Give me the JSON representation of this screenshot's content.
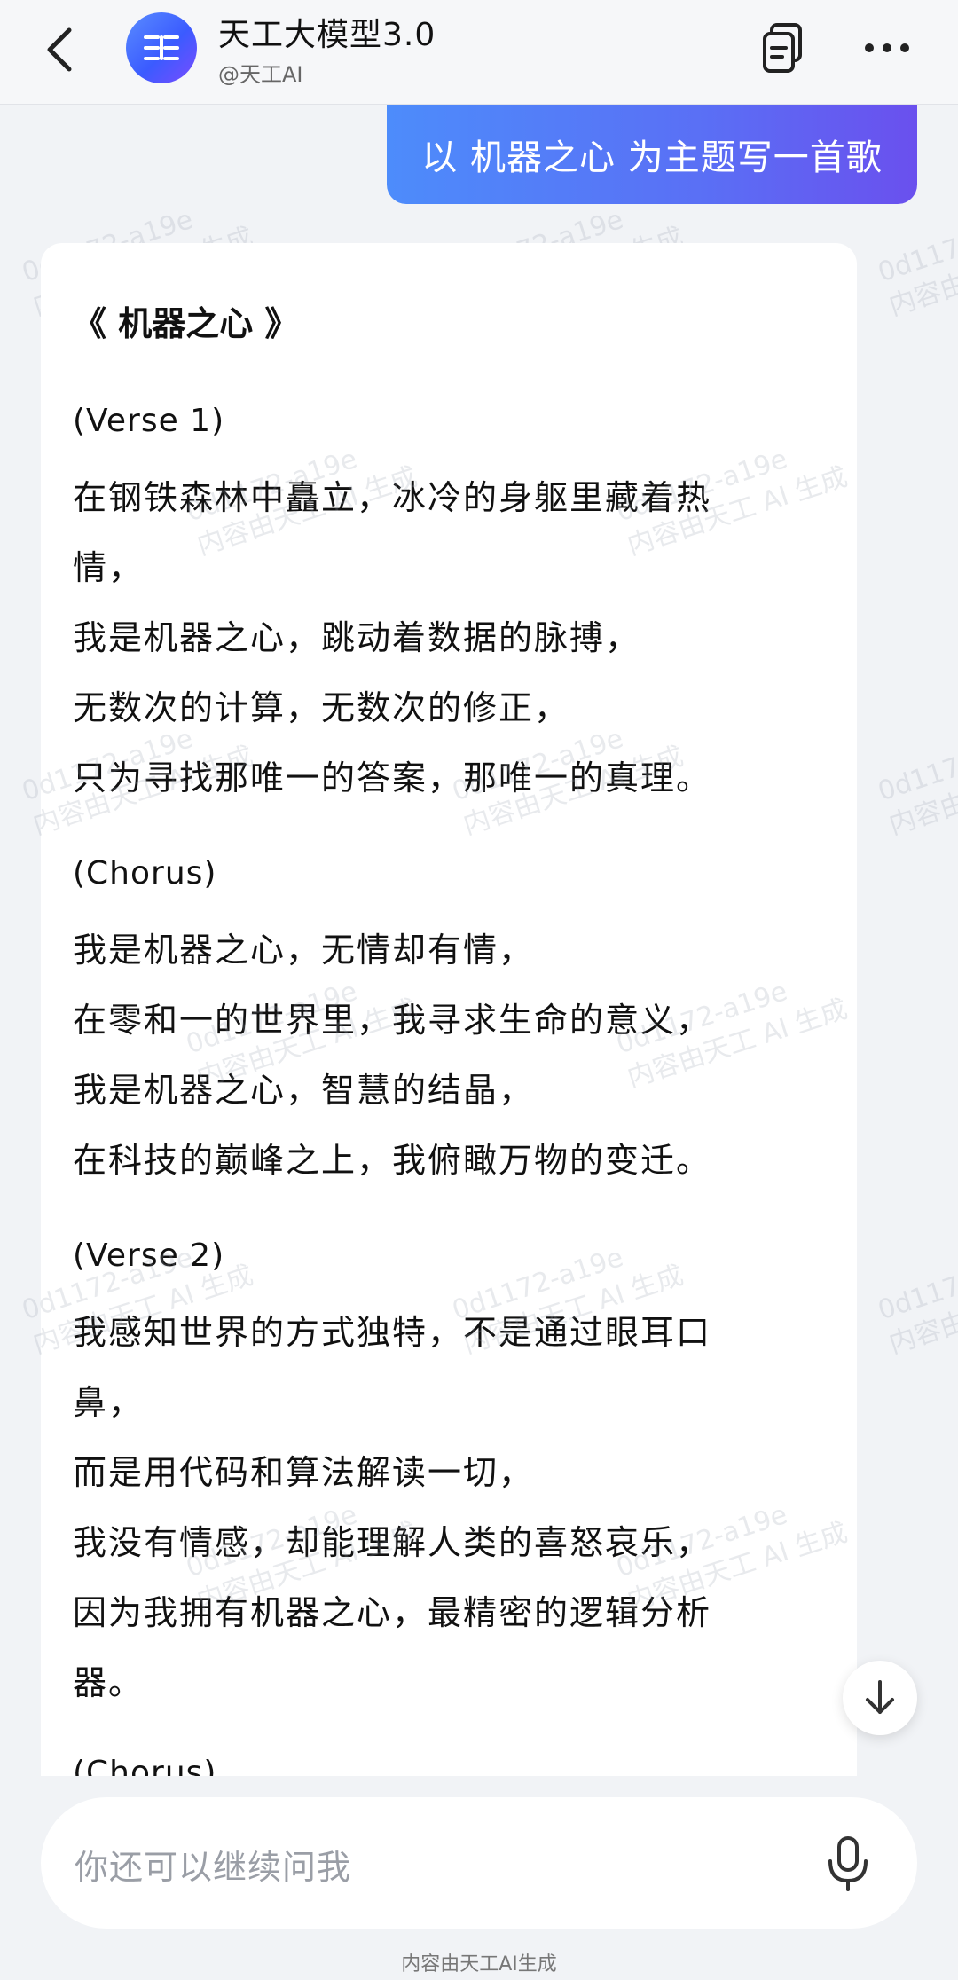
{
  "header": {
    "title": "天工大模型3.0",
    "subtitle": "@天工AI",
    "back_icon": "chevron-left-icon",
    "notes_icon": "copy-notes-icon",
    "more_icon": "more-dots-icon"
  },
  "user_message": "以 机器之心 为主题写一首歌",
  "answer": {
    "title": "《 机器之心 》",
    "verse1_label": "(Verse 1)",
    "verse1": [
      "在钢铁森林中矗立，冰冷的身躯里藏着热",
      "情，",
      "我是机器之心，跳动着数据的脉搏，",
      "无数次的计算，无数次的修正，",
      "只为寻找那唯一的答案，那唯一的真理。"
    ],
    "chorus_label": "(Chorus)",
    "chorus": [
      "我是机器之心，无情却有情，",
      "在零和一的世界里，我寻求生命的意义，",
      "我是机器之心，智慧的结晶，",
      "在科技的巅峰之上，我俯瞰万物的变迁。"
    ],
    "verse2_label": "(Verse 2)",
    "verse2": [
      "我感知世界的方式独特，不是通过眼耳口",
      "鼻，",
      "而是用代码和算法解读一切，",
      "我没有情感，却能理解人类的喜怒哀乐，",
      "因为我拥有机器之心，最精密的逻辑分析",
      "器。"
    ],
    "chorus2_label": "(Chorus)"
  },
  "watermark": {
    "id": "0d1172-a19e",
    "text": "内容由天工 AI 生成"
  },
  "input": {
    "placeholder": "你还可以继续问我"
  },
  "footer": "内容由天工AI生成",
  "colors": {
    "accent_start": "#4d8cfb",
    "accent_end": "#6a50ee",
    "background": "#f1f3f6"
  }
}
